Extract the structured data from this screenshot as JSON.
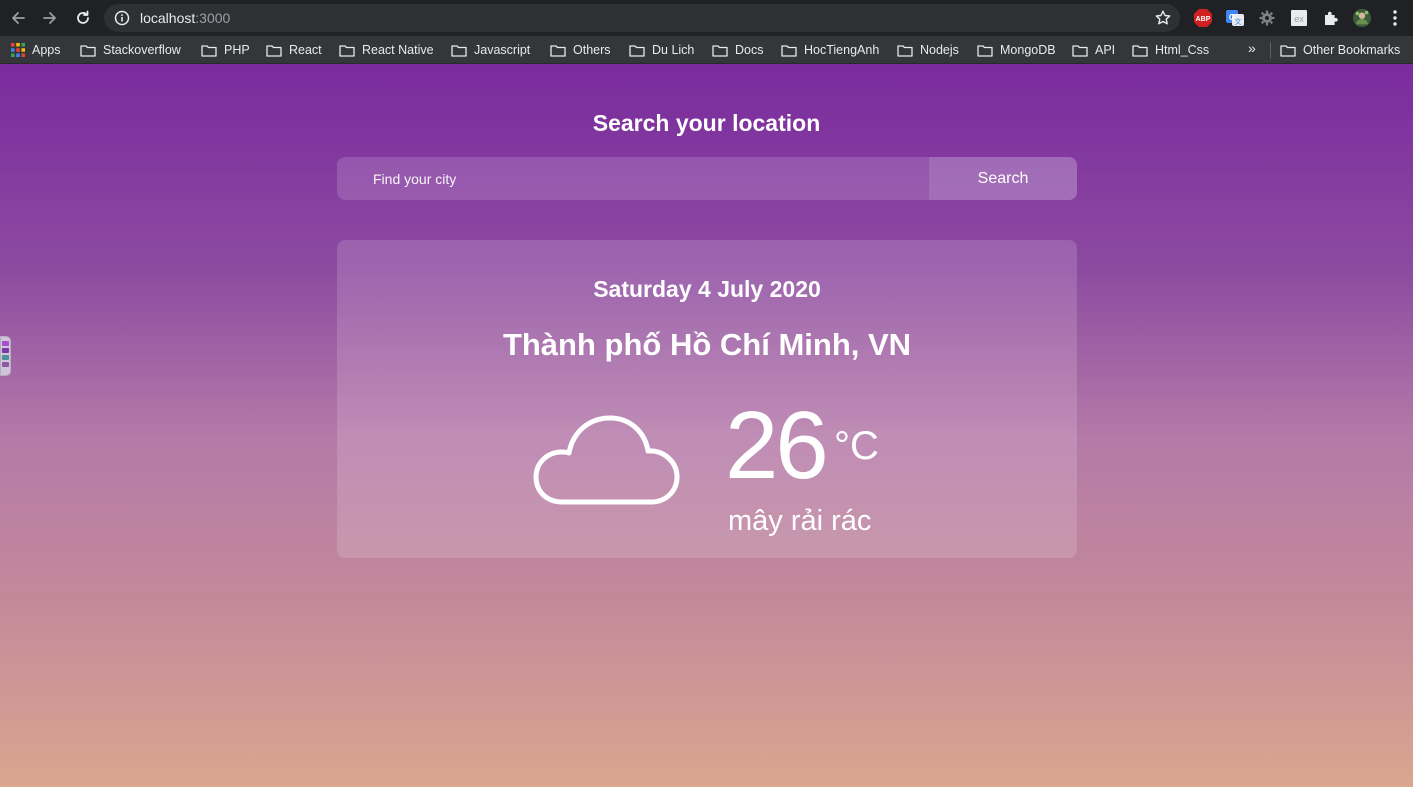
{
  "browser": {
    "url_host": "localhost",
    "url_port": ":3000",
    "nav_icons": [
      "back-arrow-icon",
      "forward-arrow-icon",
      "reload-icon"
    ],
    "extension_icons": [
      "adblock-plus-icon",
      "google-translate-icon",
      "gear-extension-icon",
      "ex-extension-icon",
      "extensions-puzzle-icon",
      "profile-avatar-icon",
      "menu-kebab-icon"
    ],
    "adblock_label": "ABP"
  },
  "bookmarks": {
    "apps_label": "Apps",
    "items": [
      "Stackoverflow",
      "PHP",
      "React",
      "React Native",
      "Javascript",
      "Others",
      "Du Lich",
      "Docs",
      "HocTiengAnh",
      "Nodejs",
      "MongoDB",
      "API",
      "Html_Css"
    ],
    "more_label": "»",
    "other_label": "Other Bookmarks"
  },
  "search": {
    "title": "Search your location",
    "placeholder": "Find your city",
    "button_label": "Search"
  },
  "weather": {
    "date": "Saturday 4 July 2020",
    "location": "Thành phố Hồ Chí Minh, VN",
    "temperature": "26",
    "unit": "°C",
    "condition": "mây rải rác",
    "icon": "cloud-icon"
  },
  "colors": {
    "gradient_top": "#7a2a9e",
    "gradient_bottom": "#daa68f",
    "chrome_dark": "#202124"
  }
}
